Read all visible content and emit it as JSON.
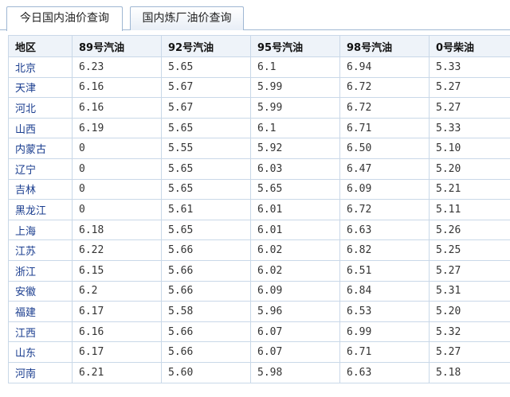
{
  "tabs": [
    {
      "label": "今日国内油价查询",
      "active": true
    },
    {
      "label": "国内炼厂油价查询",
      "active": false
    }
  ],
  "table": {
    "headers": [
      "地区",
      "89号汽油",
      "92号汽油",
      "95号汽油",
      "98号汽油",
      "0号柴油"
    ],
    "rows": [
      [
        "北京",
        "6.23",
        "5.65",
        "6.1",
        "6.94",
        "5.33"
      ],
      [
        "天津",
        "6.16",
        "5.67",
        "5.99",
        "6.72",
        "5.27"
      ],
      [
        "河北",
        "6.16",
        "5.67",
        "5.99",
        "6.72",
        "5.27"
      ],
      [
        "山西",
        "6.19",
        "5.65",
        "6.1",
        "6.71",
        "5.33"
      ],
      [
        "内蒙古",
        "0",
        "5.55",
        "5.92",
        "6.50",
        "5.10"
      ],
      [
        "辽宁",
        "0",
        "5.65",
        "6.03",
        "6.47",
        "5.20"
      ],
      [
        "吉林",
        "0",
        "5.65",
        "5.65",
        "6.09",
        "5.21"
      ],
      [
        "黑龙江",
        "0",
        "5.61",
        "6.01",
        "6.72",
        "5.11"
      ],
      [
        "上海",
        "6.18",
        "5.65",
        "6.01",
        "6.63",
        "5.26"
      ],
      [
        "江苏",
        "6.22",
        "5.66",
        "6.02",
        "6.82",
        "5.25"
      ],
      [
        "浙江",
        "6.15",
        "5.66",
        "6.02",
        "6.51",
        "5.27"
      ],
      [
        "安徽",
        "6.2",
        "5.66",
        "6.09",
        "6.84",
        "5.31"
      ],
      [
        "福建",
        "6.17",
        "5.58",
        "5.96",
        "6.53",
        "5.20"
      ],
      [
        "江西",
        "6.16",
        "5.66",
        "6.07",
        "6.99",
        "5.32"
      ],
      [
        "山东",
        "6.17",
        "5.66",
        "6.07",
        "6.71",
        "5.27"
      ],
      [
        "河南",
        "6.21",
        "5.60",
        "5.98",
        "6.63",
        "5.18"
      ]
    ]
  },
  "colors": {
    "tab_border": "#9fb7d3",
    "header_bg": "#eef3f9",
    "grid": "#c9d8e8",
    "region_text": "#1a3d8f"
  }
}
